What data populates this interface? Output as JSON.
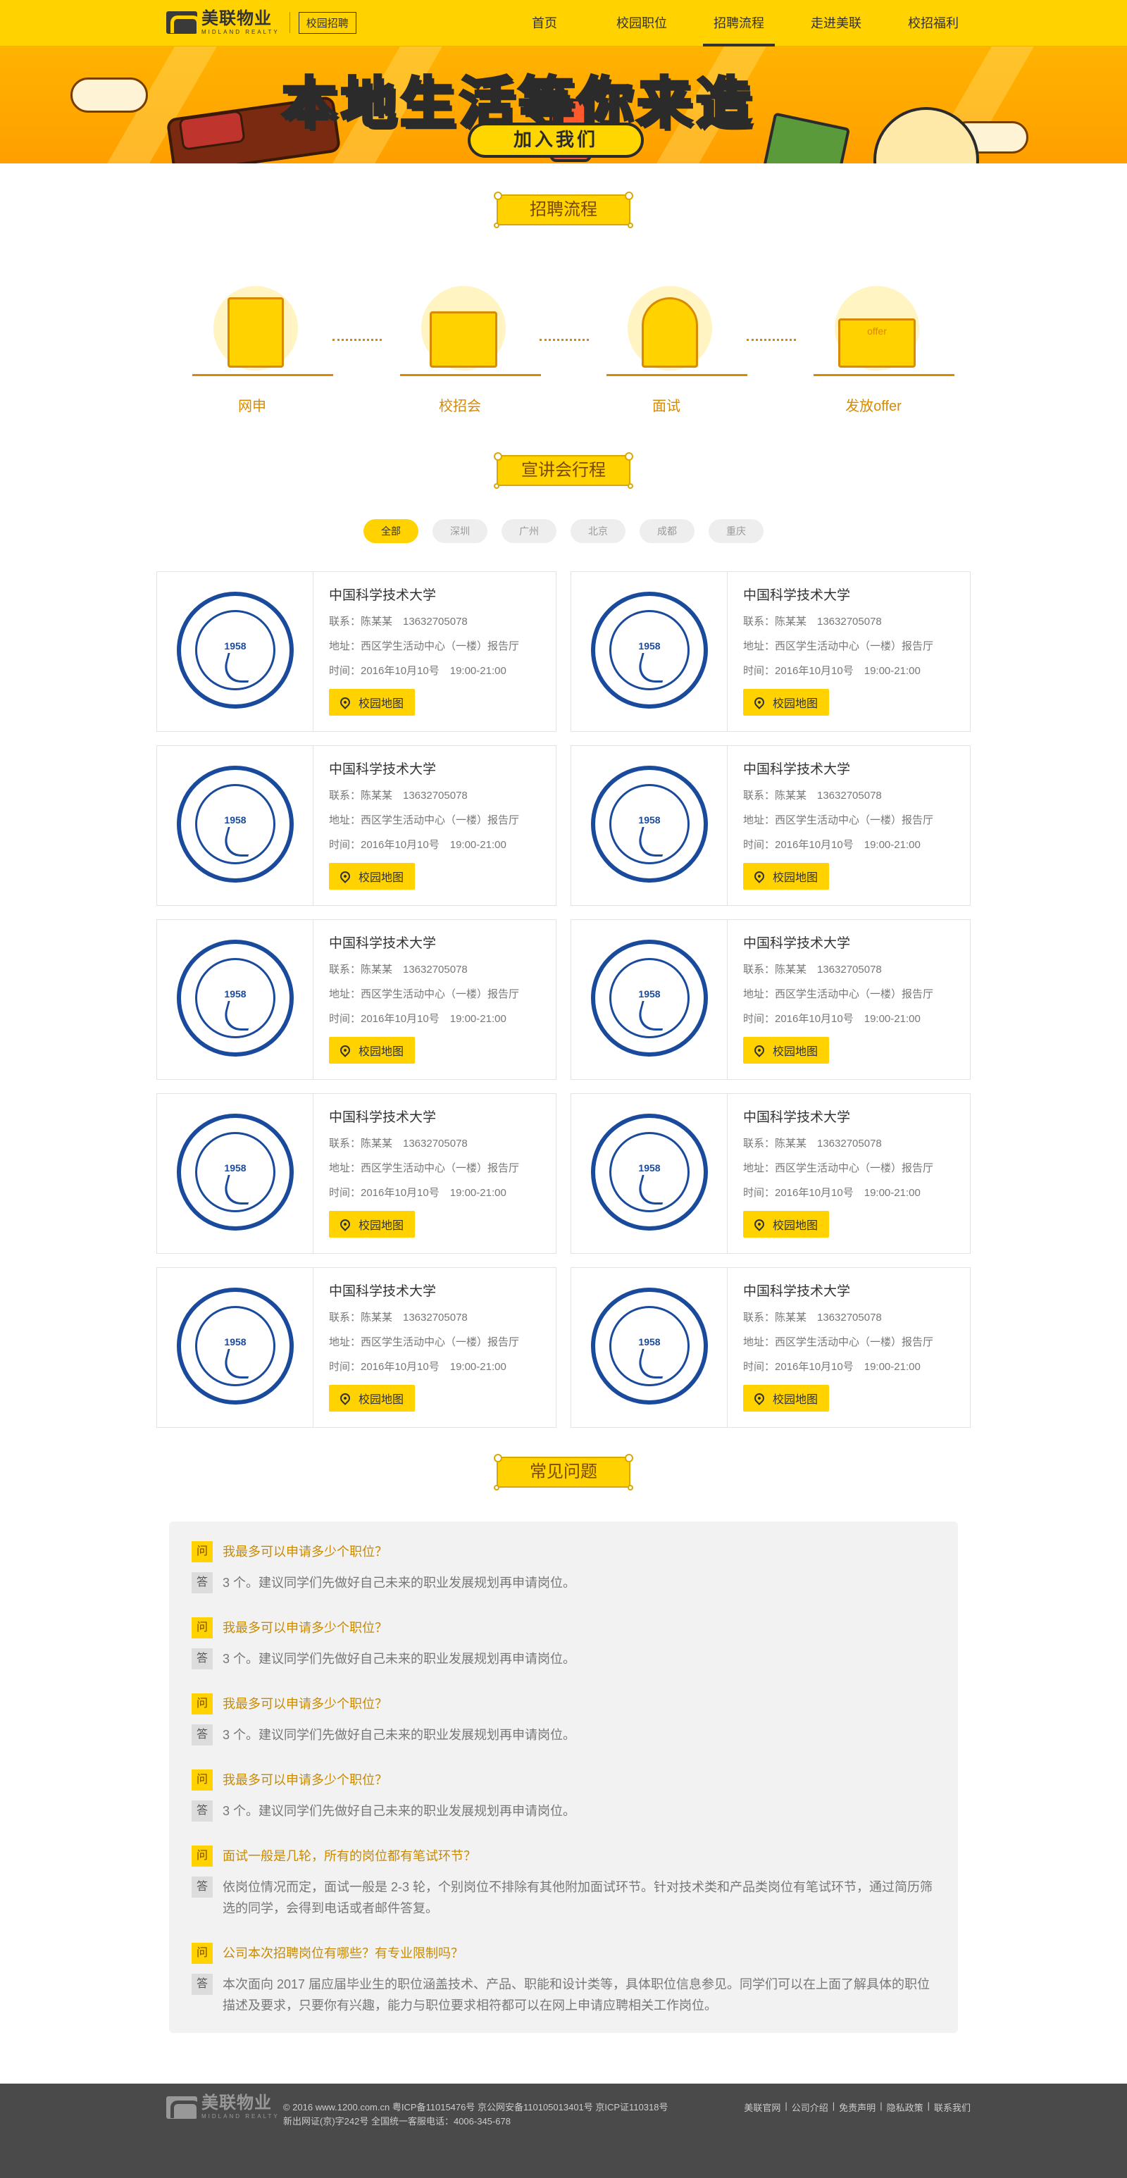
{
  "header": {
    "logo_cn": "美联物业",
    "logo_en": "MIDLAND REALTY",
    "badge": "校园招聘",
    "nav": [
      {
        "label": "首页",
        "active": false
      },
      {
        "label": "校园职位",
        "active": false
      },
      {
        "label": "招聘流程",
        "active": true
      },
      {
        "label": "走进美联",
        "active": false
      },
      {
        "label": "校招福利",
        "active": false
      }
    ]
  },
  "banner": {
    "title": "本地生活等你来造",
    "cta": "加入我们"
  },
  "process": {
    "title": "招聘流程",
    "steps": [
      {
        "label": "网申",
        "icon": "application-form-icon"
      },
      {
        "label": "校招会",
        "icon": "school-building-icon"
      },
      {
        "label": "面试",
        "icon": "interviewer-icon"
      },
      {
        "label": "发放offer",
        "icon": "offer-envelope-icon",
        "icon_text": "offer"
      }
    ]
  },
  "sessions": {
    "title": "宣讲会行程",
    "filters": [
      {
        "label": "全部",
        "active": true
      },
      {
        "label": "深圳",
        "active": false
      },
      {
        "label": "广州",
        "active": false
      },
      {
        "label": "北京",
        "active": false
      },
      {
        "label": "成都",
        "active": false
      },
      {
        "label": "重庆",
        "active": false
      }
    ],
    "seal_year": "1958",
    "cards": [
      {
        "name": "中国科学技术大学",
        "contact": "联系：陈某某　13632705078",
        "address": "地址：西区学生活动中心（一楼）报告厅",
        "time": "时间：2016年10月10号　19:00-21:00",
        "map": "校园地图"
      },
      {
        "name": "中国科学技术大学",
        "contact": "联系：陈某某　13632705078",
        "address": "地址：西区学生活动中心（一楼）报告厅",
        "time": "时间：2016年10月10号　19:00-21:00",
        "map": "校园地图"
      },
      {
        "name": "中国科学技术大学",
        "contact": "联系：陈某某　13632705078",
        "address": "地址：西区学生活动中心（一楼）报告厅",
        "time": "时间：2016年10月10号　19:00-21:00",
        "map": "校园地图"
      },
      {
        "name": "中国科学技术大学",
        "contact": "联系：陈某某　13632705078",
        "address": "地址：西区学生活动中心（一楼）报告厅",
        "time": "时间：2016年10月10号　19:00-21:00",
        "map": "校园地图"
      },
      {
        "name": "中国科学技术大学",
        "contact": "联系：陈某某　13632705078",
        "address": "地址：西区学生活动中心（一楼）报告厅",
        "time": "时间：2016年10月10号　19:00-21:00",
        "map": "校园地图"
      },
      {
        "name": "中国科学技术大学",
        "contact": "联系：陈某某　13632705078",
        "address": "地址：西区学生活动中心（一楼）报告厅",
        "time": "时间：2016年10月10号　19:00-21:00",
        "map": "校园地图"
      },
      {
        "name": "中国科学技术大学",
        "contact": "联系：陈某某　13632705078",
        "address": "地址：西区学生活动中心（一楼）报告厅",
        "time": "时间：2016年10月10号　19:00-21:00",
        "map": "校园地图"
      },
      {
        "name": "中国科学技术大学",
        "contact": "联系：陈某某　13632705078",
        "address": "地址：西区学生活动中心（一楼）报告厅",
        "time": "时间：2016年10月10号　19:00-21:00",
        "map": "校园地图"
      },
      {
        "name": "中国科学技术大学",
        "contact": "联系：陈某某　13632705078",
        "address": "地址：西区学生活动中心（一楼）报告厅",
        "time": "时间：2016年10月10号　19:00-21:00",
        "map": "校园地图"
      },
      {
        "name": "中国科学技术大学",
        "contact": "联系：陈某某　13632705078",
        "address": "地址：西区学生活动中心（一楼）报告厅",
        "time": "时间：2016年10月10号　19:00-21:00",
        "map": "校园地图"
      }
    ]
  },
  "faq": {
    "title": "常见问题",
    "q_tag": "问",
    "a_tag": "答",
    "items": [
      {
        "q": "我最多可以申请多少个职位？",
        "a": "3 个。建议同学们先做好自己未来的职业发展规划再申请岗位。"
      },
      {
        "q": "我最多可以申请多少个职位？",
        "a": "3 个。建议同学们先做好自己未来的职业发展规划再申请岗位。"
      },
      {
        "q": "我最多可以申请多少个职位？",
        "a": "3 个。建议同学们先做好自己未来的职业发展规划再申请岗位。"
      },
      {
        "q": "我最多可以申请多少个职位？",
        "a": "3 个。建议同学们先做好自己未来的职业发展规划再申请岗位。"
      },
      {
        "q": "面试一般是几轮，所有的岗位都有笔试环节？",
        "a": "依岗位情况而定，面试一般是 2-3 轮，个别岗位不排除有其他附加面试环节。针对技术类和产品类岗位有笔试环节，通过简历筛选的同学，会得到电话或者邮件答复。"
      },
      {
        "q": "公司本次招聘岗位有哪些？有专业限制吗？",
        "a": "本次面向 2017 届应届毕业生的职位涵盖技术、产品、职能和设计类等，具体职位信息参见。同学们可以在上面了解具体的职位描述及要求，只要你有兴趣，能力与职位要求相符都可以在网上申请应聘相关工作岗位。"
      }
    ]
  },
  "footer": {
    "logo_cn": "美联物业",
    "logo_en": "MIDLAND REALTY",
    "line1": "© 2016 www.1200.com.cn 粤ICP备11015476号 京公网安备1101050134​01号 京ICP证110318号",
    "line2": "新出网证(京)字242号 全国统一客服电话：4006-345-678",
    "links": [
      "美联官网",
      "公司介绍",
      "免责声明",
      "隐私政策",
      "联系我们"
    ]
  },
  "colors": {
    "brand_yellow": "#ffd200",
    "accent_brown": "#d88a00",
    "seal_blue": "#1a4a9c",
    "footer_bg": "#4a4a4a"
  }
}
